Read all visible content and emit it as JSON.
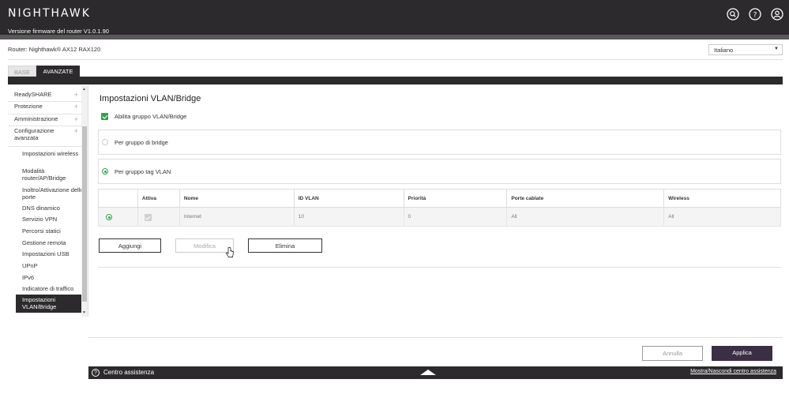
{
  "header": {
    "logo": "NIGHTHAWK",
    "firmware": "Versione firmware del router V1.0.1.90",
    "icons": [
      "search-icon",
      "help-icon",
      "account-icon"
    ]
  },
  "router": {
    "label": "Router: Nighthawk® AX12 RAX120"
  },
  "language": {
    "selected": "Italiano"
  },
  "tabs": [
    {
      "label": "BASE",
      "active": false
    },
    {
      "label": "AVANZATE",
      "active": true
    }
  ],
  "sidebar": {
    "sections": [
      {
        "label": "ReadySHARE",
        "expanded": false
      },
      {
        "label": "Protezione",
        "expanded": false
      },
      {
        "label": "Amministrazione",
        "expanded": false
      },
      {
        "label": "Configurazione avanzata",
        "expanded": true
      }
    ],
    "items": [
      "Impostazioni wireless",
      "Modalità router/AP/Bridge",
      "Inoltro/Attivazione delle porte",
      "DNS dinamico",
      "Servizio VPN",
      "Percorsi statici",
      "Gestione remota",
      "Impostazioni USB",
      "UPnP",
      "IPv6",
      "Indicatore di traffico",
      "Impostazioni VLAN/Bridge"
    ]
  },
  "main": {
    "title": "Impostazioni VLAN/Bridge",
    "enable_label": "Abilita gruppo VLAN/Bridge",
    "option_bridge": "Per gruppo di bridge",
    "option_vlan": "Per gruppo tag VLAN",
    "table": {
      "headers": [
        "",
        "Attiva",
        "Nome",
        "ID VLAN",
        "Priorità",
        "Porte cablate",
        "Wireless"
      ],
      "rows": [
        {
          "name": "Internet",
          "vlan_id": "10",
          "priority": "0",
          "wired_ports": "All",
          "wireless": "All"
        }
      ]
    },
    "buttons": {
      "add": "Aggiungi",
      "edit": "Modifica",
      "delete": "Elimina"
    }
  },
  "actions": {
    "cancel": "Annulla",
    "apply": "Applica"
  },
  "footer": {
    "help": "Centro assistenza",
    "toggle": "Mostra/Nascondi centro assistenza"
  },
  "colors": {
    "header_bg": "#2c2a2c",
    "accent_green": "#28a745",
    "apply_bg": "#3b2e45"
  }
}
